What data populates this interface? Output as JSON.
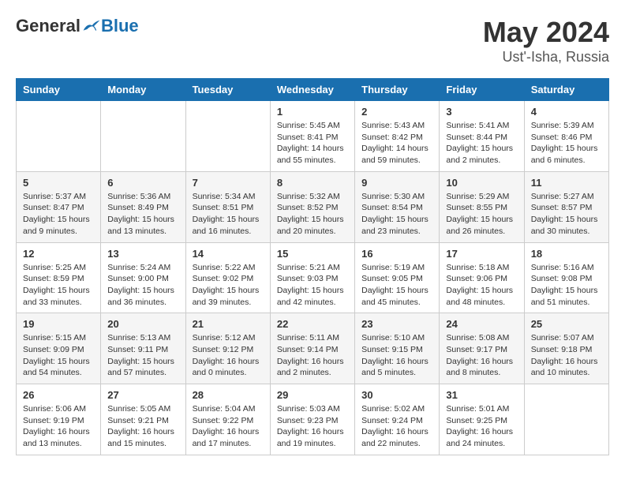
{
  "header": {
    "logo_general": "General",
    "logo_blue": "Blue",
    "title": "May 2024",
    "location": "Ust'-Isha, Russia"
  },
  "days_of_week": [
    "Sunday",
    "Monday",
    "Tuesday",
    "Wednesday",
    "Thursday",
    "Friday",
    "Saturday"
  ],
  "weeks": [
    {
      "shade": "white",
      "days": [
        {
          "num": "",
          "info": ""
        },
        {
          "num": "",
          "info": ""
        },
        {
          "num": "",
          "info": ""
        },
        {
          "num": "1",
          "info": "Sunrise: 5:45 AM\nSunset: 8:41 PM\nDaylight: 14 hours\nand 55 minutes."
        },
        {
          "num": "2",
          "info": "Sunrise: 5:43 AM\nSunset: 8:42 PM\nDaylight: 14 hours\nand 59 minutes."
        },
        {
          "num": "3",
          "info": "Sunrise: 5:41 AM\nSunset: 8:44 PM\nDaylight: 15 hours\nand 2 minutes."
        },
        {
          "num": "4",
          "info": "Sunrise: 5:39 AM\nSunset: 8:46 PM\nDaylight: 15 hours\nand 6 minutes."
        }
      ]
    },
    {
      "shade": "shaded",
      "days": [
        {
          "num": "5",
          "info": "Sunrise: 5:37 AM\nSunset: 8:47 PM\nDaylight: 15 hours\nand 9 minutes."
        },
        {
          "num": "6",
          "info": "Sunrise: 5:36 AM\nSunset: 8:49 PM\nDaylight: 15 hours\nand 13 minutes."
        },
        {
          "num": "7",
          "info": "Sunrise: 5:34 AM\nSunset: 8:51 PM\nDaylight: 15 hours\nand 16 minutes."
        },
        {
          "num": "8",
          "info": "Sunrise: 5:32 AM\nSunset: 8:52 PM\nDaylight: 15 hours\nand 20 minutes."
        },
        {
          "num": "9",
          "info": "Sunrise: 5:30 AM\nSunset: 8:54 PM\nDaylight: 15 hours\nand 23 minutes."
        },
        {
          "num": "10",
          "info": "Sunrise: 5:29 AM\nSunset: 8:55 PM\nDaylight: 15 hours\nand 26 minutes."
        },
        {
          "num": "11",
          "info": "Sunrise: 5:27 AM\nSunset: 8:57 PM\nDaylight: 15 hours\nand 30 minutes."
        }
      ]
    },
    {
      "shade": "white",
      "days": [
        {
          "num": "12",
          "info": "Sunrise: 5:25 AM\nSunset: 8:59 PM\nDaylight: 15 hours\nand 33 minutes."
        },
        {
          "num": "13",
          "info": "Sunrise: 5:24 AM\nSunset: 9:00 PM\nDaylight: 15 hours\nand 36 minutes."
        },
        {
          "num": "14",
          "info": "Sunrise: 5:22 AM\nSunset: 9:02 PM\nDaylight: 15 hours\nand 39 minutes."
        },
        {
          "num": "15",
          "info": "Sunrise: 5:21 AM\nSunset: 9:03 PM\nDaylight: 15 hours\nand 42 minutes."
        },
        {
          "num": "16",
          "info": "Sunrise: 5:19 AM\nSunset: 9:05 PM\nDaylight: 15 hours\nand 45 minutes."
        },
        {
          "num": "17",
          "info": "Sunrise: 5:18 AM\nSunset: 9:06 PM\nDaylight: 15 hours\nand 48 minutes."
        },
        {
          "num": "18",
          "info": "Sunrise: 5:16 AM\nSunset: 9:08 PM\nDaylight: 15 hours\nand 51 minutes."
        }
      ]
    },
    {
      "shade": "shaded",
      "days": [
        {
          "num": "19",
          "info": "Sunrise: 5:15 AM\nSunset: 9:09 PM\nDaylight: 15 hours\nand 54 minutes."
        },
        {
          "num": "20",
          "info": "Sunrise: 5:13 AM\nSunset: 9:11 PM\nDaylight: 15 hours\nand 57 minutes."
        },
        {
          "num": "21",
          "info": "Sunrise: 5:12 AM\nSunset: 9:12 PM\nDaylight: 16 hours\nand 0 minutes."
        },
        {
          "num": "22",
          "info": "Sunrise: 5:11 AM\nSunset: 9:14 PM\nDaylight: 16 hours\nand 2 minutes."
        },
        {
          "num": "23",
          "info": "Sunrise: 5:10 AM\nSunset: 9:15 PM\nDaylight: 16 hours\nand 5 minutes."
        },
        {
          "num": "24",
          "info": "Sunrise: 5:08 AM\nSunset: 9:17 PM\nDaylight: 16 hours\nand 8 minutes."
        },
        {
          "num": "25",
          "info": "Sunrise: 5:07 AM\nSunset: 9:18 PM\nDaylight: 16 hours\nand 10 minutes."
        }
      ]
    },
    {
      "shade": "white",
      "days": [
        {
          "num": "26",
          "info": "Sunrise: 5:06 AM\nSunset: 9:19 PM\nDaylight: 16 hours\nand 13 minutes."
        },
        {
          "num": "27",
          "info": "Sunrise: 5:05 AM\nSunset: 9:21 PM\nDaylight: 16 hours\nand 15 minutes."
        },
        {
          "num": "28",
          "info": "Sunrise: 5:04 AM\nSunset: 9:22 PM\nDaylight: 16 hours\nand 17 minutes."
        },
        {
          "num": "29",
          "info": "Sunrise: 5:03 AM\nSunset: 9:23 PM\nDaylight: 16 hours\nand 19 minutes."
        },
        {
          "num": "30",
          "info": "Sunrise: 5:02 AM\nSunset: 9:24 PM\nDaylight: 16 hours\nand 22 minutes."
        },
        {
          "num": "31",
          "info": "Sunrise: 5:01 AM\nSunset: 9:25 PM\nDaylight: 16 hours\nand 24 minutes."
        },
        {
          "num": "",
          "info": ""
        }
      ]
    }
  ]
}
